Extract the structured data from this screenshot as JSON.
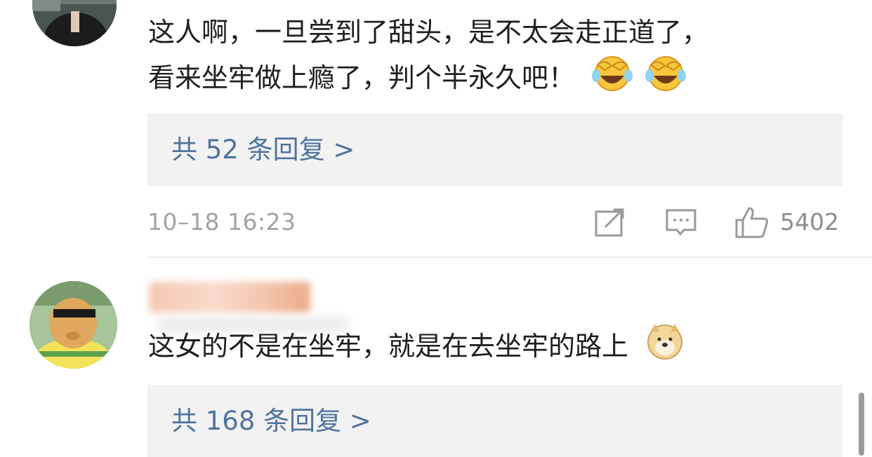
{
  "comments": [
    {
      "text_line1": "这人啊，一旦尝到了甜头，是不太会走正道了，",
      "text_line2": "看来坐牢做上瘾了，判个半永久吧！",
      "emoji": [
        "laughing-cry-emoji",
        "laughing-cry-emoji"
      ],
      "reply_summary": "共 52 条回复 >",
      "timestamp": "10–18 16:23",
      "like_count": "5402"
    },
    {
      "text": "这女的不是在坐牢，就是在去坐牢的路上",
      "emoji": [
        "doge-emoji"
      ],
      "reply_summary": "共 168 条回复 >"
    }
  ],
  "colors": {
    "reply_link": "#50739e",
    "reply_bg": "#f2f2f2",
    "meta_gray": "#a3a3a3",
    "text": "#1f1f1f"
  }
}
